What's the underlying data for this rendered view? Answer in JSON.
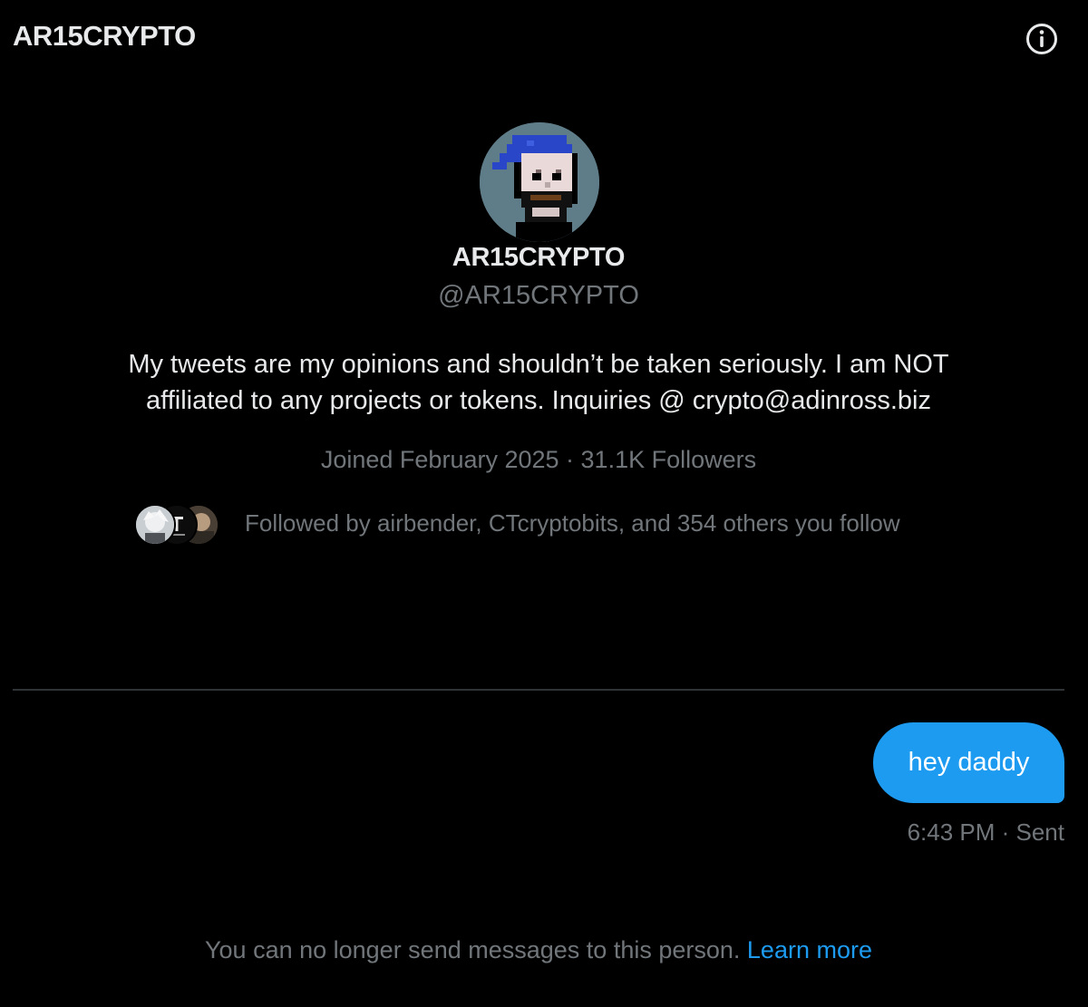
{
  "header": {
    "title": "AR15CRYPTO",
    "info_icon": "info-circle-icon"
  },
  "profile": {
    "display_name": "AR15CRYPTO",
    "handle": "@AR15CRYPTO",
    "bio_lines": [
      "My tweets are my opinions and shouldn’t be taken seriously. I am NOT",
      "affiliated to any projects or tokens. Inquiries @ crypto@adinross.biz"
    ],
    "joined": "Joined February 2025",
    "separator": " · ",
    "followers": "31.1K Followers",
    "followed_by": "Followed by airbender, CTcryptobits, and 354 others you follow"
  },
  "conversation": {
    "messages": [
      {
        "text": "hey daddy",
        "direction": "outgoing",
        "time": "6:43 PM",
        "status": "Sent"
      }
    ],
    "notice": "You can no longer send messages to this person.",
    "learn_more": "Learn more"
  },
  "colors": {
    "background": "#000000",
    "text_primary": "#e7e9ea",
    "text_secondary": "#71767b",
    "accent": "#1d9bf0",
    "divider": "#2f3336"
  }
}
